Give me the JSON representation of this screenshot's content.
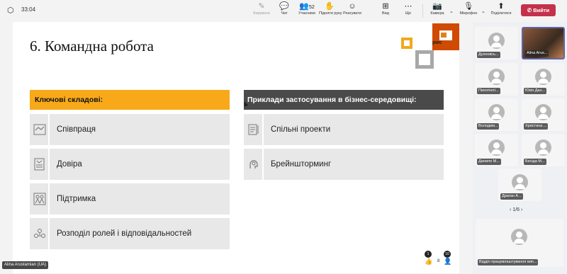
{
  "meeting": {
    "timer": "33:04",
    "toolbar": [
      {
        "label": "Керувати",
        "icon": "pen-icon",
        "dim": true
      },
      {
        "label": "Чат",
        "icon": "chat-icon"
      },
      {
        "label": "Учасники",
        "icon": "people-icon",
        "count": "52"
      },
      {
        "label": "Підняти руку",
        "icon": "hand-icon"
      },
      {
        "label": "Реагувати",
        "icon": "smile-icon"
      },
      {
        "label": "Вид",
        "icon": "grid-icon"
      },
      {
        "label": "Ще",
        "icon": "more-icon"
      },
      {
        "label": "Камера",
        "icon": "camera-off-icon"
      },
      {
        "label": "Мікрофон",
        "icon": "mic-off-icon"
      },
      {
        "label": "Поділитися",
        "icon": "share-icon"
      }
    ],
    "leave_label": "Вийти"
  },
  "slide": {
    "title": "6. Командна робота",
    "logo_text": "pwc",
    "left_header": "Ключові складові:",
    "right_header": "Приклади застосування в бізнес-середовищі:",
    "left_items": [
      "Співпраця",
      "Довіра",
      "Підтримка",
      "Розподіл ролей і відповідальностей"
    ],
    "right_items": [
      "Спільні проекти",
      "Брейншторминг"
    ]
  },
  "participants": {
    "tiles": [
      "Духновсь...",
      "Alina Arus...",
      "Пихотіної...",
      "Юкія Дан...",
      "Володим...",
      "Христина ...",
      "Данило М...",
      "Бесіда М...",
      "Драган А..."
    ],
    "pager": "1/6",
    "bottom_tile": "Відділ працевлаштування вип..."
  },
  "self_view": {
    "name": "Alina Arustamian (UA)",
    "reaction_counts": [
      "1",
      "10"
    ],
    "count_label": "8"
  },
  "colors": {
    "accent_orange": "#f8a919",
    "header_dark": "#4a4a4a",
    "leave_red": "#c4314b",
    "pwc_orange": "#d04a02"
  }
}
